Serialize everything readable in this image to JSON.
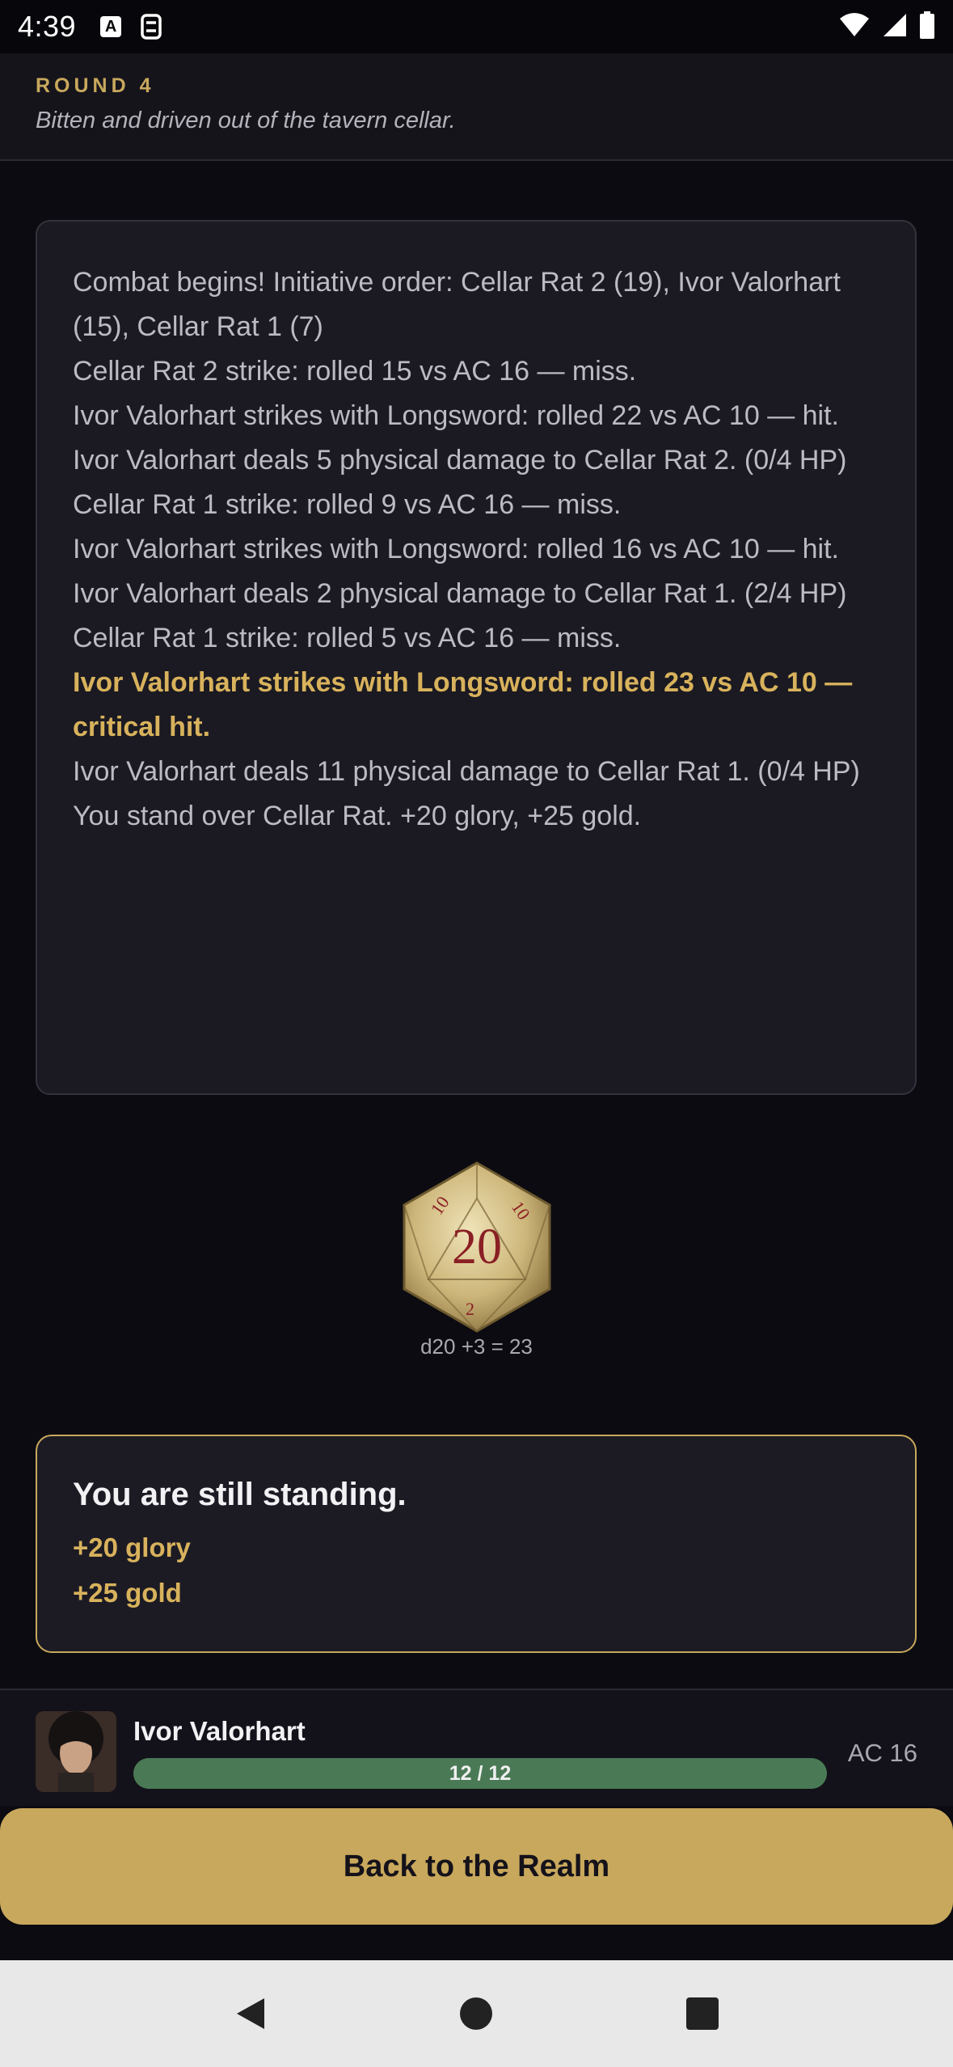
{
  "status_bar": {
    "time": "4:39",
    "icons": [
      "a-badge-icon",
      "sync-icon",
      "wifi-icon",
      "signal-icon",
      "battery-icon"
    ]
  },
  "header": {
    "round_label": "ROUND 4",
    "subtitle": "Bitten and driven out of the tavern cellar."
  },
  "combat_log": [
    {
      "text": "Combat begins! Initiative order: Cellar Rat 2 (19), Ivor Valorhart (15), Cellar Rat 1 (7)",
      "critical": false
    },
    {
      "text": "Cellar Rat 2 strike: rolled 15 vs AC 16 — miss.",
      "critical": false
    },
    {
      "text": "Ivor Valorhart strikes with Longsword: rolled 22 vs AC 10 — hit.",
      "critical": false
    },
    {
      "text": "Ivor Valorhart deals 5 physical damage to Cellar Rat 2. (0/4 HP)",
      "critical": false
    },
    {
      "text": "Cellar Rat 1 strike: rolled 9 vs AC 16 — miss.",
      "critical": false
    },
    {
      "text": "Ivor Valorhart strikes with Longsword: rolled 16 vs AC 10 — hit.",
      "critical": false
    },
    {
      "text": "Ivor Valorhart deals 2 physical damage to Cellar Rat 1. (2/4 HP)",
      "critical": false
    },
    {
      "text": "Cellar Rat 1 strike: rolled 5 vs AC 16 — miss.",
      "critical": false
    },
    {
      "text": "Ivor Valorhart strikes with Longsword: rolled 23 vs AC 10 — critical hit.",
      "critical": true
    },
    {
      "text": "Ivor Valorhart deals 11 physical damage to Cellar Rat 1. (0/4 HP)",
      "critical": false
    },
    {
      "text": "You stand over Cellar Rat. +20 glory, +25 gold.",
      "critical": false
    }
  ],
  "die": {
    "face": "20",
    "caption": "d20 +3 = 23"
  },
  "result": {
    "title": "You are still standing.",
    "glory": "+20 glory",
    "gold": "+25 gold"
  },
  "character": {
    "name": "Ivor Valorhart",
    "hp_text": "12 / 12",
    "hp_fraction": 1.0,
    "ac": "AC 16"
  },
  "back_button": "Back to the Realm",
  "colors": {
    "accent_gold": "#c8a85c",
    "hp_green": "#4a7a55",
    "background": "#0c0b11"
  }
}
